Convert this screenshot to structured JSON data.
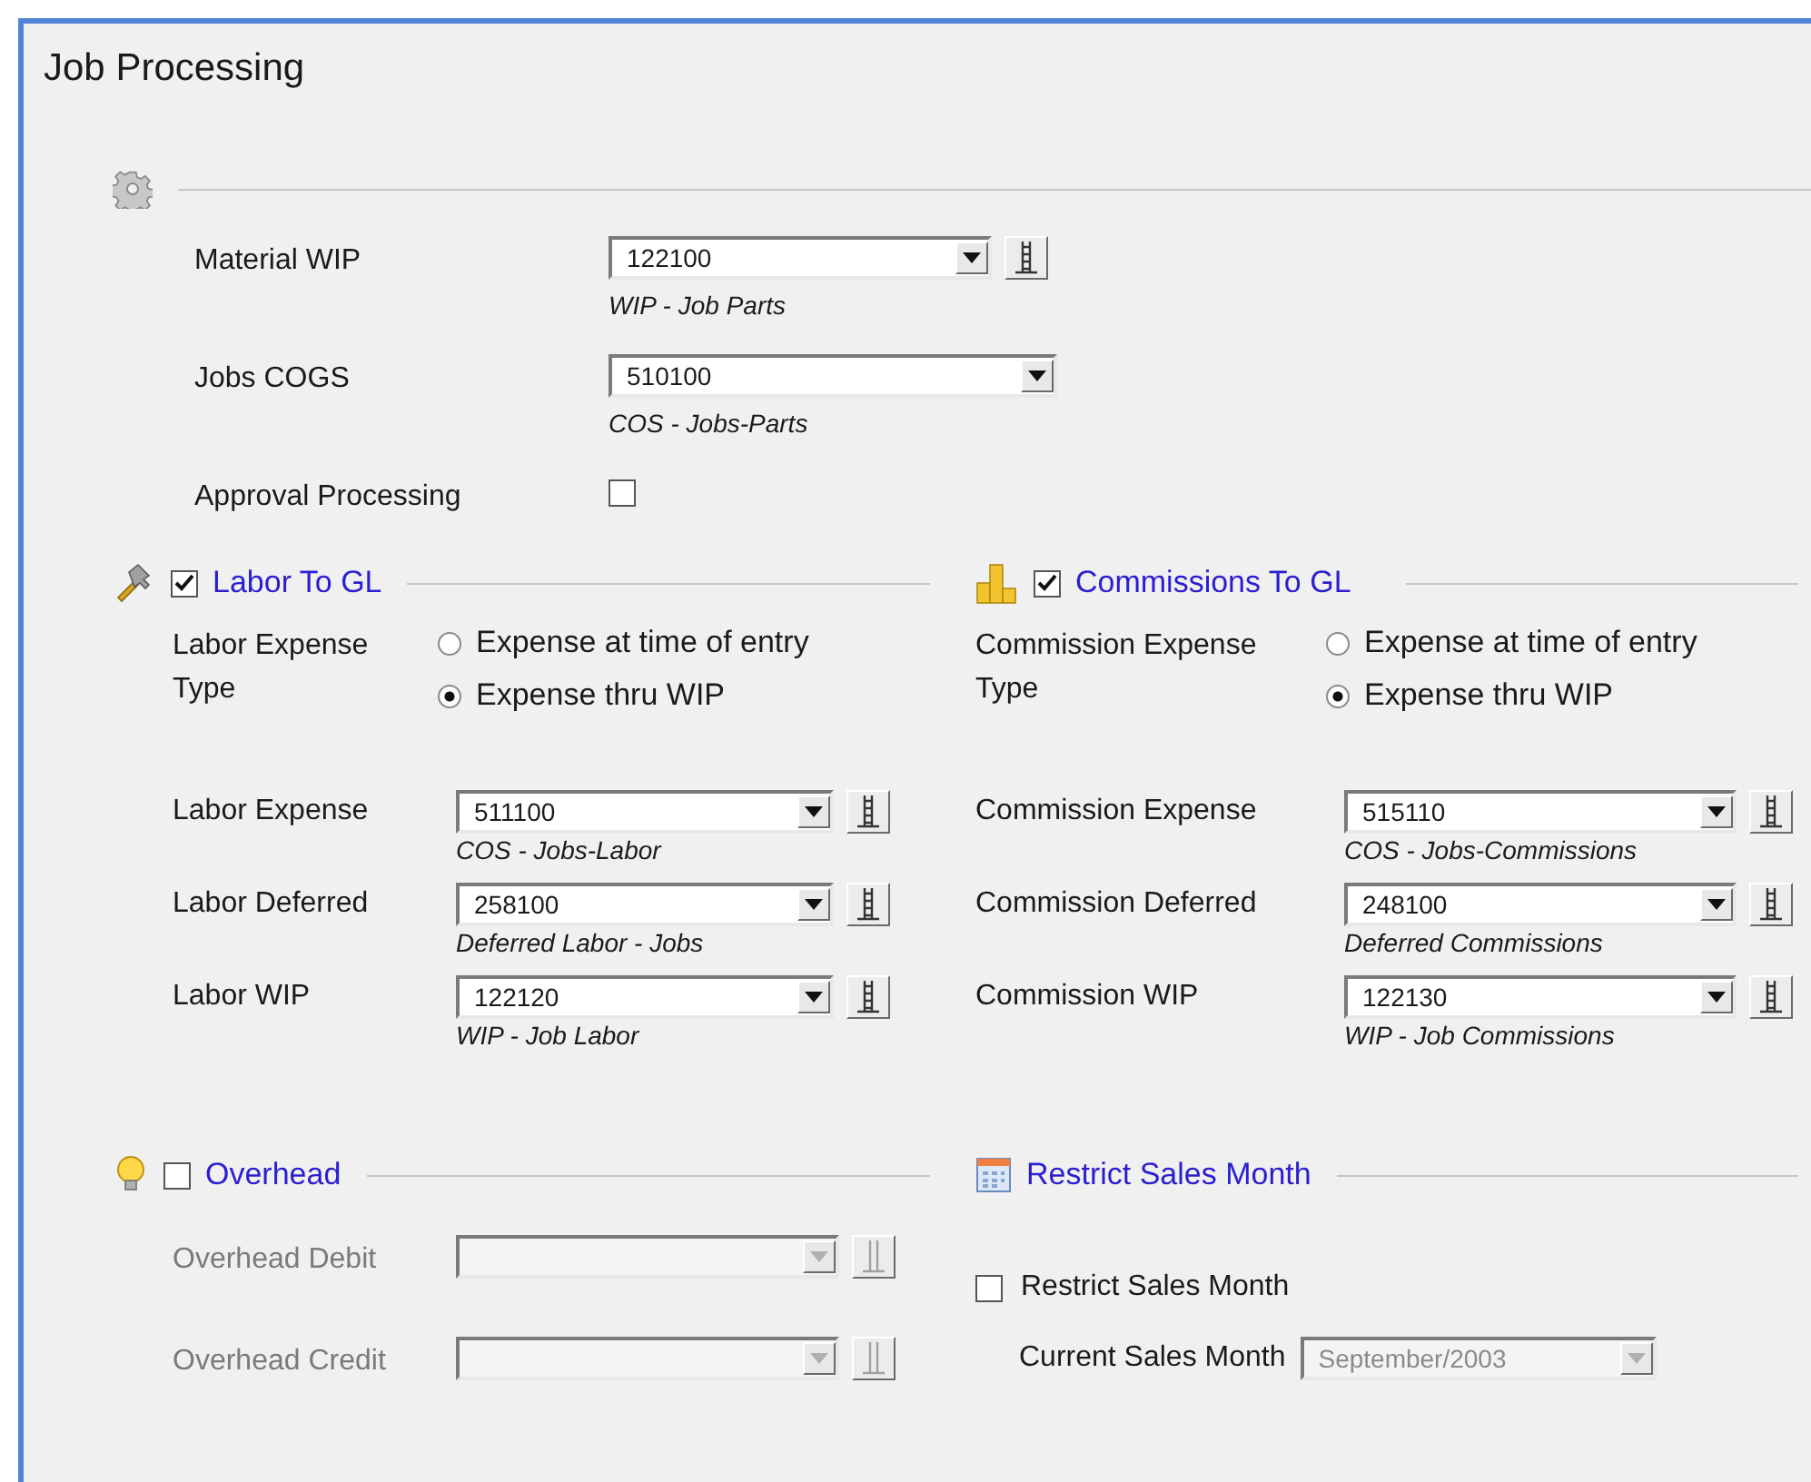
{
  "window": {
    "title": "Job Processing"
  },
  "general": {
    "fields": [
      {
        "kind": "combo",
        "label": "Material WIP",
        "value": "122100",
        "description": "WIP - Job Parts",
        "lookup": true
      },
      {
        "kind": "combo",
        "label": "Jobs COGS",
        "value": "510100",
        "description": "COS - Jobs-Parts",
        "lookup": false
      },
      {
        "kind": "checkbox",
        "label": "Approval Processing",
        "checked": false
      }
    ]
  },
  "labor": {
    "title": "Labor To GL",
    "checked": true,
    "expense_type": {
      "label": "Labor Expense Type",
      "options": [
        {
          "label": "Expense at time of entry",
          "selected": false
        },
        {
          "label": "Expense thru WIP",
          "selected": true
        }
      ]
    },
    "accounts": [
      {
        "label": "Labor Expense",
        "value": "511100",
        "description": "COS - Jobs-Labor",
        "disabled": false
      },
      {
        "label": "Labor Deferred",
        "value": "258100",
        "description": "Deferred Labor - Jobs",
        "disabled": false
      },
      {
        "label": "Labor WIP",
        "value": "122120",
        "description": "WIP - Job Labor",
        "disabled": false
      }
    ]
  },
  "commissions": {
    "title": "Commissions To GL",
    "checked": true,
    "expense_type": {
      "label": "Commission Expense Type",
      "options": [
        {
          "label": "Expense at time of entry",
          "selected": false
        },
        {
          "label": "Expense thru WIP",
          "selected": true
        }
      ]
    },
    "accounts": [
      {
        "label": "Commission Expense",
        "value": "515110",
        "description": "COS - Jobs-Commissions",
        "disabled": false
      },
      {
        "label": "Commission Deferred",
        "value": "248100",
        "description": "Deferred Commissions",
        "disabled": false
      },
      {
        "label": "Commission WIP",
        "value": "122130",
        "description": "WIP - Job Commissions",
        "disabled": false
      }
    ]
  },
  "overhead": {
    "title": "Overhead",
    "checked": false,
    "accounts": [
      {
        "label": "Overhead Debit",
        "disabled": true
      },
      {
        "label": "Overhead Credit",
        "disabled": true
      }
    ]
  },
  "restrict_sales_month": {
    "title": "Restrict Sales Month",
    "checkbox": {
      "label": "Restrict Sales Month",
      "checked": false
    },
    "current_month": {
      "label": "Current Sales Month",
      "value": "September/2003",
      "disabled": true
    }
  }
}
